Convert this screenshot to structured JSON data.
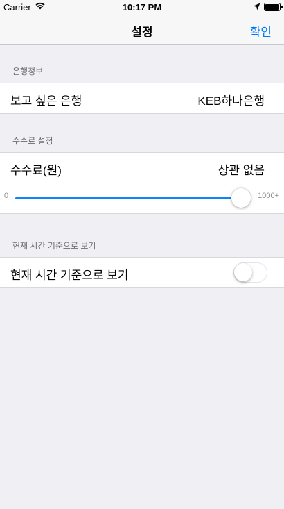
{
  "status_bar": {
    "carrier": "Carrier",
    "time": "10:17 PM",
    "icons": [
      "wifi-icon",
      "location-arrow-icon",
      "battery-icon"
    ]
  },
  "nav": {
    "title": "설정",
    "confirm_label": "확인",
    "accent_color": "#007aff"
  },
  "sections": {
    "bank": {
      "header": "은행정보",
      "row_label": "보고 싶은 은행",
      "row_value": "KEB하나은행"
    },
    "fee": {
      "header": "수수료 설정",
      "row_label": "수수료(원)",
      "row_value": "상관 없음",
      "slider": {
        "min_label": "0",
        "max_label": "1000+",
        "value_fraction": 1.0
      }
    },
    "time": {
      "header": "현재 시간 기준으로 보기",
      "row_label": "현재 시간 기준으로 보기",
      "toggle_on": false
    }
  }
}
